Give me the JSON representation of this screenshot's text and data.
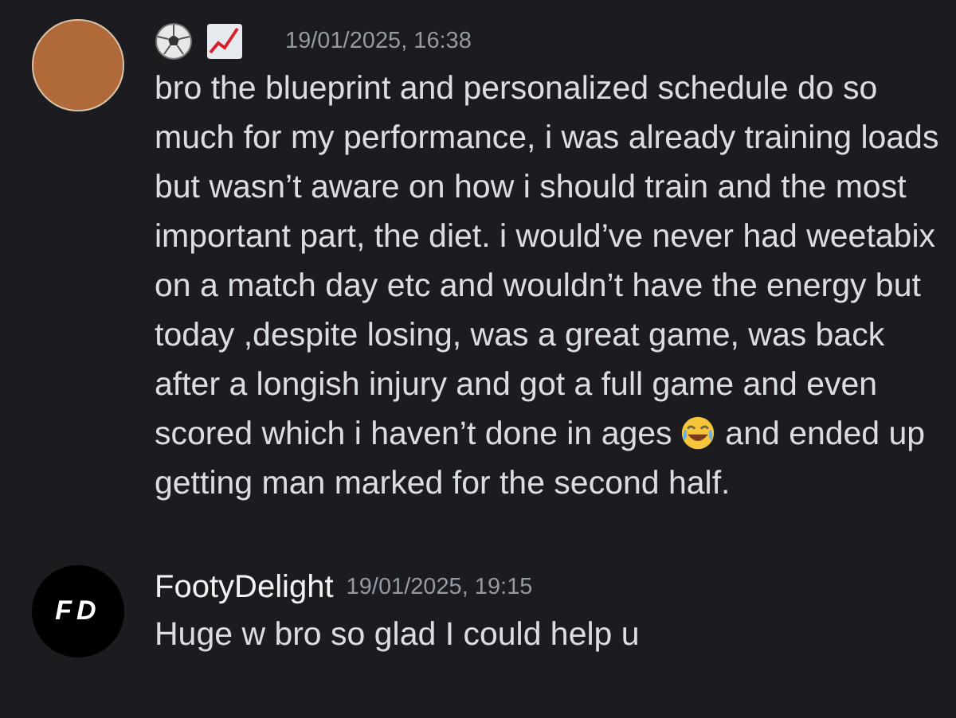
{
  "messages": [
    {
      "avatar": {
        "kind": "photo"
      },
      "author_badges": [
        {
          "kind": "soccer-ball"
        },
        {
          "kind": "chart"
        }
      ],
      "timestamp": "19/01/2025, 16:38",
      "content": [
        {
          "kind": "text",
          "text": "bro the blueprint and personalized schedule do so much for my performance, i was already training loads but wasn’t aware on how i should train and the most important part, the diet. i would’ve never had weetabix on a match day etc and wouldn’t have the energy but today ,despite losing, was a great game, was back after a longish injury and got a full game and even scored which i haven’t done in ages "
        },
        {
          "kind": "emoji"
        },
        {
          "kind": "text",
          "text": " and ended up getting man marked for the second half."
        }
      ]
    },
    {
      "avatar": {
        "kind": "logo",
        "text": "FD"
      },
      "author": "FootyDelight",
      "timestamp": "19/01/2025, 19:15",
      "content": [
        {
          "kind": "text",
          "text": "Huge w bro so glad I could help u"
        }
      ]
    }
  ]
}
